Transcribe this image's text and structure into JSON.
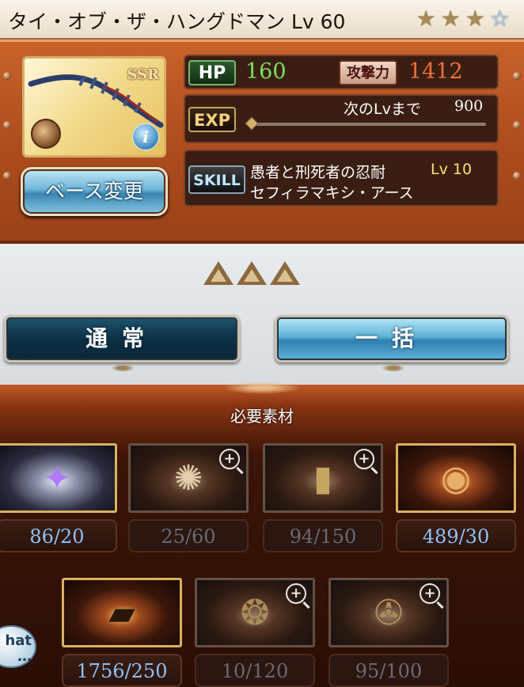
{
  "header": {
    "title": "タイ・オブ・ザ・ハングドマン Lv 60",
    "stars": [
      {
        "icon": "star-icon",
        "state": "filled"
      },
      {
        "icon": "star-icon",
        "state": "filled"
      },
      {
        "icon": "star-icon",
        "state": "filled"
      },
      {
        "icon": "star-icon",
        "state": "empty"
      }
    ]
  },
  "weapon": {
    "rarity_badge": "SSR",
    "element_icon": "earth-element-icon",
    "info_icon_label": "i",
    "base_change_button": "ベース変更"
  },
  "stats": {
    "hp_label": "HP",
    "hp_value": "160",
    "atk_label": "攻撃力",
    "atk_value": "1412",
    "exp_label": "EXP",
    "next_lv_label": "次のLvまで",
    "next_lv_value": "900",
    "exp_progress": 0.0
  },
  "skill": {
    "label": "SKILL",
    "name": "愚者と刑死者の忍耐",
    "level": "Lv 10",
    "subname": "セフィラマキシ・アース"
  },
  "upgrade": {
    "uncap_icons": [
      "uncap-triangle-icon",
      "uncap-triangle-icon",
      "uncap-triangle-icon"
    ],
    "normal_button": "通常",
    "bulk_button": "一括"
  },
  "materials": {
    "title": "必要素材",
    "row1": [
      {
        "count": "86/20",
        "icon": "dark-crystal-icon",
        "active": true,
        "zoom": false
      },
      {
        "count": "25/60",
        "icon": "light-orb-icon",
        "active": false,
        "zoom": true
      },
      {
        "count": "94/150",
        "icon": "scroll-icon",
        "active": false,
        "zoom": true
      },
      {
        "count": "489/30",
        "icon": "orb-medallion-icon",
        "active": true,
        "zoom": false
      }
    ],
    "row2": [
      {
        "count": "1756/250",
        "icon": "tablet-icon",
        "active": true,
        "zoom": false
      },
      {
        "count": "10/120",
        "icon": "coin-icon",
        "active": false,
        "zoom": true
      },
      {
        "count": "95/100",
        "icon": "swirl-emblem-icon",
        "active": false,
        "zoom": true
      }
    ]
  },
  "chat": {
    "label": "hat\n..."
  },
  "colors": {
    "hp": "#7ce060",
    "atk": "#f0703a",
    "skill_lv": "#f2e66a",
    "count_active": "#8dc2f7",
    "panel": "#b0521f"
  }
}
